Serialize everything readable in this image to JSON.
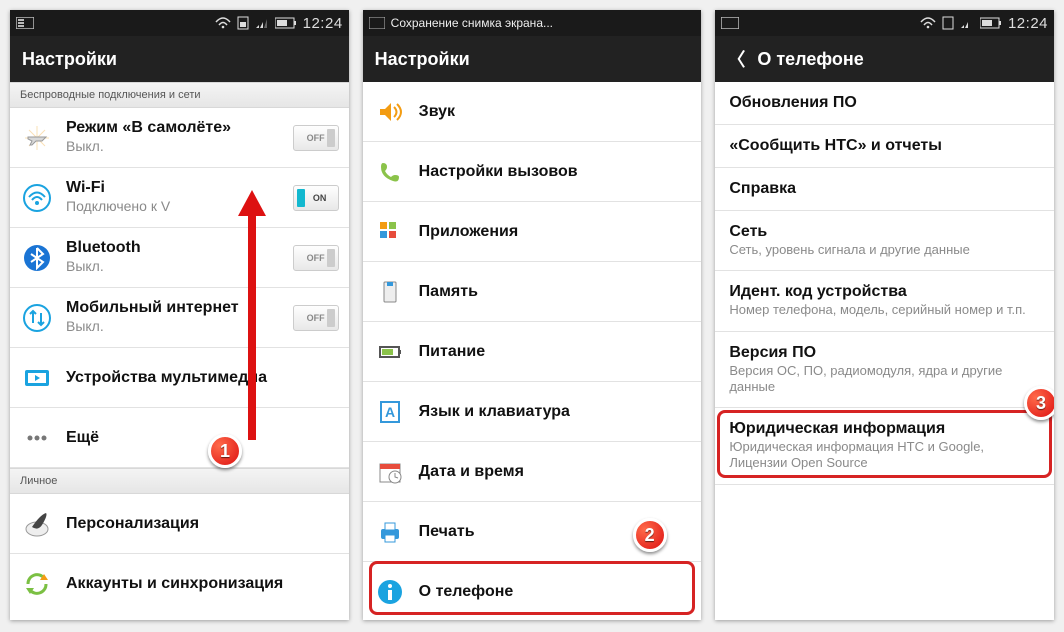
{
  "status": {
    "time": "12:24",
    "saving": "Сохранение снимка экрана..."
  },
  "screen1": {
    "title": "Настройки",
    "hdr1": "Беспроводные подключения и сети",
    "hdr2": "Личное",
    "airplane": {
      "t": "Режим «В самолёте»",
      "s": "Выкл."
    },
    "wifi": {
      "t": "Wi-Fi",
      "s": "Подключено к V"
    },
    "bt": {
      "t": "Bluetooth",
      "s": "Выкл."
    },
    "data": {
      "t": "Мобильный интернет",
      "s": "Выкл."
    },
    "media": {
      "t": "Устройства мультимедиа"
    },
    "more": {
      "t": "Ещё"
    },
    "pers": {
      "t": "Персонализация"
    },
    "acct": {
      "t": "Аккаунты и синхронизация"
    },
    "on": "ON",
    "off": "OFF"
  },
  "screen2": {
    "title": "Настройки",
    "items": [
      "Звук",
      "Настройки вызовов",
      "Приложения",
      "Память",
      "Питание",
      "Язык и клавиатура",
      "Дата и время",
      "Печать",
      "О телефоне"
    ]
  },
  "screen3": {
    "title": "О телефоне",
    "items": [
      {
        "t": "Обновления ПО"
      },
      {
        "t": "«Сообщить HTC» и отчеты"
      },
      {
        "t": "Справка"
      },
      {
        "t": "Сеть",
        "s": "Сеть, уровень сигнала и другие данные"
      },
      {
        "t": "Идент. код устройства",
        "s": "Номер телефона, модель, серийный номер и т.п."
      },
      {
        "t": "Версия ПО",
        "s": "Версия ОС, ПО, радиомодуля, ядра и другие данные"
      },
      {
        "t": "Юридическая информация",
        "s": "Юридическая информация HTC и Google, Лицензии Open Source"
      }
    ]
  },
  "badges": {
    "b1": "1",
    "b2": "2",
    "b3": "3"
  }
}
